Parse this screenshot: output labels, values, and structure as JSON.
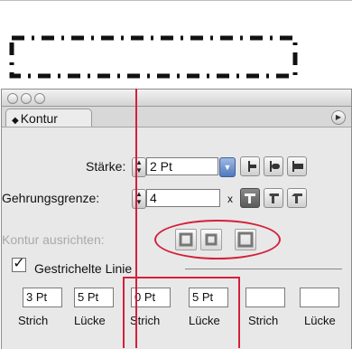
{
  "panel": {
    "tab_title": "Kontur",
    "tab_icon": "disclosure-icon",
    "weight": {
      "label": "Stärke:",
      "value": "2 Pt"
    },
    "miter": {
      "label": "Gehrungsgrenze:",
      "value": "4",
      "unit": "x"
    },
    "align": {
      "label": "Kontur ausrichten:"
    },
    "dashed": {
      "label": "Gestrichelte Linie",
      "checked": true
    },
    "dash_values": [
      "3 Pt",
      "5 Pt",
      "0 Pt",
      "5 Pt",
      "",
      ""
    ],
    "dash_labels": [
      "Strich",
      "Lücke",
      "Strich",
      "Lücke",
      "Strich",
      "Lücke"
    ]
  },
  "colors": {
    "highlight": "#d4203a",
    "panel_bg": "#e8e8e8",
    "dropdown_blue": "#4f78bf"
  }
}
